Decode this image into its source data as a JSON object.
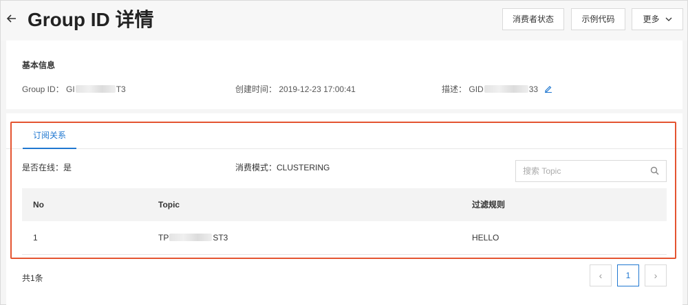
{
  "header": {
    "title": "Group ID 详情",
    "back_icon": "arrow-left-icon",
    "buttons": {
      "consumer_status": "消费者状态",
      "sample_code": "示例代码",
      "more": "更多"
    }
  },
  "basic_info": {
    "title": "基本信息",
    "group_id_label": "Group ID：",
    "group_id_prefix": "GI",
    "group_id_suffix": "T3",
    "created_label": "创建时间：",
    "created_value": "2019-12-23 17:00:41",
    "desc_label": "描述：",
    "desc_prefix": "GID",
    "desc_suffix": "33"
  },
  "subscription": {
    "tab_label": "订阅关系",
    "online_label": "是否在线：",
    "online_value": "是",
    "mode_label": "消费模式：",
    "mode_value": "CLUSTERING",
    "search_placeholder": "搜索 Topic",
    "columns": [
      "No",
      "Topic",
      "过滤规则"
    ],
    "rows": [
      {
        "no": "1",
        "topic_prefix": "TP",
        "topic_suffix": "ST3",
        "filter": "HELLO"
      }
    ],
    "total": "共1条",
    "pagination": {
      "prev": "‹",
      "current": "1",
      "next": "›"
    }
  },
  "colors": {
    "accent": "#1f77d0",
    "highlight": "#e4532f"
  }
}
